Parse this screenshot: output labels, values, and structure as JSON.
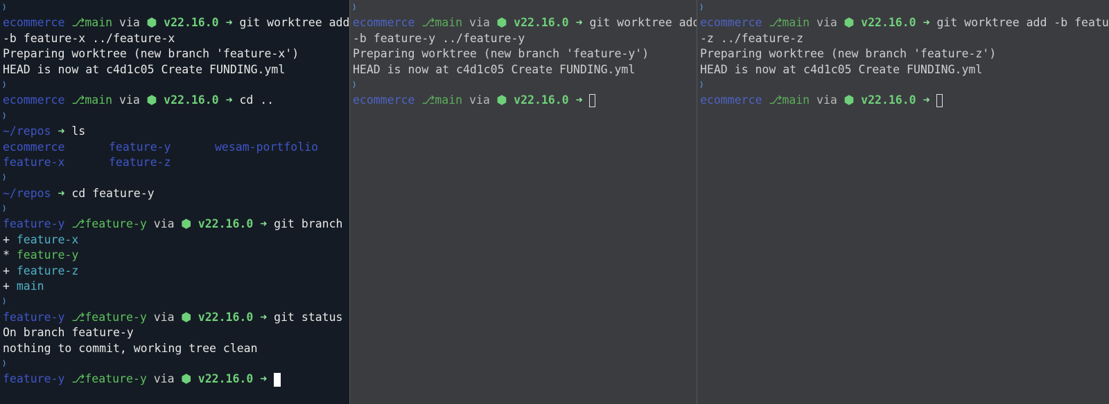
{
  "prompt": {
    "chevron": "❯",
    "arrow": "➜",
    "git_glyph": "⎇",
    "via": "via",
    "node_glyph": "⬢",
    "node_version": "v22.16.0"
  },
  "left": {
    "cmd1": {
      "dir": "ecommerce",
      "branch": "main",
      "command": "git worktree add",
      "wrap": "-b feature-x ../feature-x"
    },
    "out1": [
      "Preparing worktree (new branch 'feature-x')",
      "HEAD is now at c4d1c05 Create FUNDING.yml"
    ],
    "cmd2": {
      "dir": "ecommerce",
      "branch": "main",
      "command": "cd .."
    },
    "cmd3": {
      "dir": "~/repos",
      "command": "ls"
    },
    "ls_rows": [
      [
        "ecommerce",
        "feature-y",
        "wesam-portfolio"
      ],
      [
        "feature-x",
        "feature-z",
        ""
      ]
    ],
    "cmd4": {
      "dir": "~/repos",
      "command": "cd feature-y"
    },
    "cmd5": {
      "dir": "feature-y",
      "branch": "feature-y",
      "command": "git branch"
    },
    "branches": [
      {
        "marker": "+",
        "name": "feature-x"
      },
      {
        "marker": "*",
        "name": "feature-y"
      },
      {
        "marker": "+",
        "name": "feature-z"
      },
      {
        "marker": "+",
        "name": "main"
      }
    ],
    "cmd6": {
      "dir": "feature-y",
      "branch": "feature-y",
      "command": "git status"
    },
    "out6": [
      "On branch feature-y",
      "nothing to commit, working tree clean"
    ],
    "cmd7": {
      "dir": "feature-y",
      "branch": "feature-y"
    }
  },
  "mid": {
    "cmd1": {
      "dir": "ecommerce",
      "branch": "main",
      "command": "git worktree add",
      "wrap": "-b feature-y ../feature-y"
    },
    "out1": [
      "Preparing worktree (new branch 'feature-y')",
      "HEAD is now at c4d1c05 Create FUNDING.yml"
    ],
    "cmd2": {
      "dir": "ecommerce",
      "branch": "main"
    }
  },
  "right": {
    "cmd1": {
      "dir": "ecommerce",
      "branch": "main",
      "command": "git worktree add -b feature",
      "wrap": "-z ../feature-z"
    },
    "out1": [
      "Preparing worktree (new branch 'feature-z')",
      "HEAD is now at c4d1c05 Create FUNDING.yml"
    ],
    "cmd2": {
      "dir": "ecommerce",
      "branch": "main"
    }
  }
}
